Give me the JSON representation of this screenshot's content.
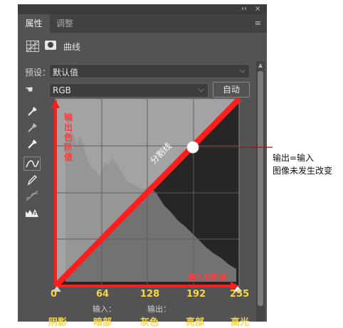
{
  "window": {
    "collapse_glyph": "‹‹",
    "close_glyph": "×",
    "menu_glyph": "≡"
  },
  "tabs": [
    {
      "label": "属性",
      "active": true
    },
    {
      "label": "调整",
      "active": false
    }
  ],
  "panel_header": {
    "title": "曲线",
    "icons": [
      "curves-adjustment-icon",
      "layer-mask-icon"
    ]
  },
  "preset": {
    "label": "预设：",
    "value": "默认值"
  },
  "channel": {
    "value": "RGB",
    "auto_label": "自动"
  },
  "tools": [
    "on-image-adjust-icon",
    "black-point-eyedropper-icon",
    "gray-point-eyedropper-icon",
    "white-point-eyedropper-icon",
    "curve-edit-icon",
    "pencil-icon",
    "smooth-curve-icon",
    "clipping-warning-icon"
  ],
  "curve": {
    "input_ticks": [
      "0",
      "64",
      "128",
      "192",
      "255"
    ],
    "control_point": {
      "input": 192,
      "output": 192
    },
    "annotations": {
      "output_axis": [
        "输",
        "出",
        "色",
        "阶",
        "值"
      ],
      "input_axis": "输入色阶值",
      "diagonal": "分割线"
    },
    "io_labels": [
      "输入：",
      "输出："
    ],
    "zones": [
      "阴影",
      "暗部",
      "灰色",
      "亮部",
      "高光"
    ]
  },
  "callout": {
    "line1": "输出=输入",
    "line2": "图像未发生改变"
  },
  "colors": {
    "panel_bg": "#535353",
    "annotation_red": "#ff2020",
    "tick_yellow": "#f7d64a"
  }
}
